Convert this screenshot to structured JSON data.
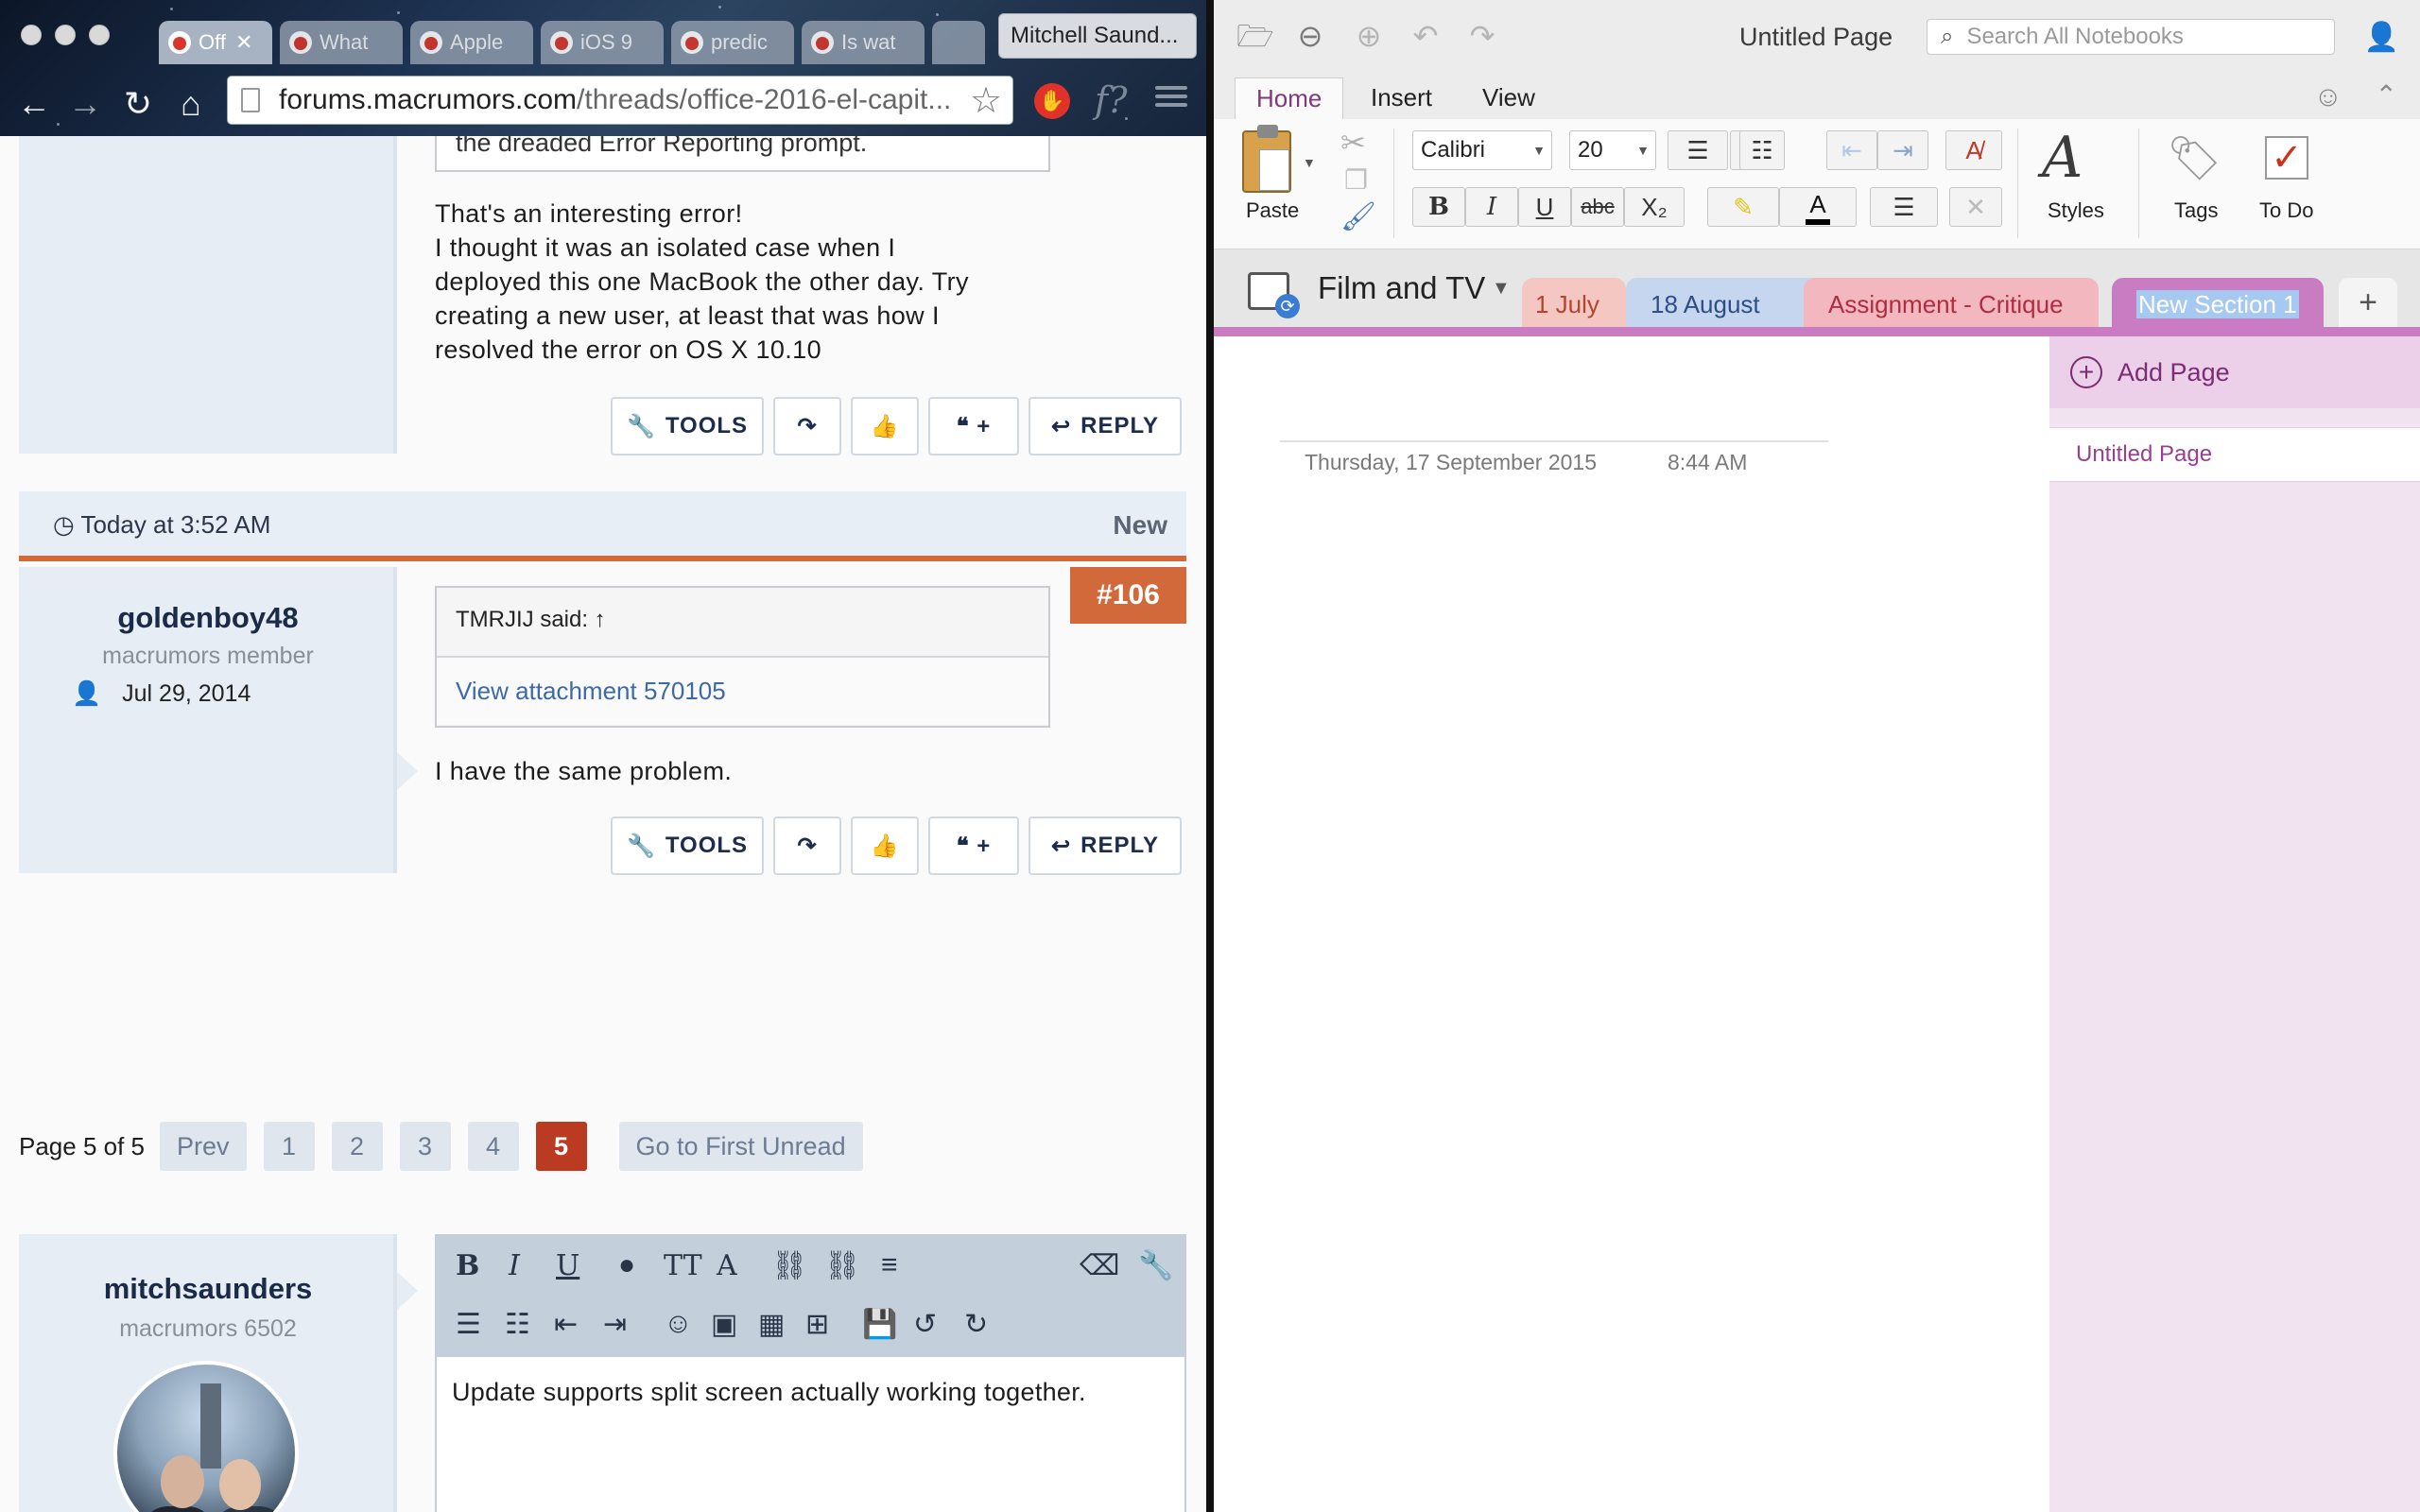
{
  "browser": {
    "tabs": [
      {
        "label": "Off",
        "active": true
      },
      {
        "label": "What"
      },
      {
        "label": "Apple"
      },
      {
        "label": "iOS 9"
      },
      {
        "label": "predic"
      },
      {
        "label": "Is wat"
      }
    ],
    "profile_name": "Mitchell Saund...",
    "url_host": "forums.macrumors.com",
    "url_path": "/threads/office-2016-el-capit...",
    "ext_icon_glyph": "✋",
    "ext2_glyph": "f?"
  },
  "forum": {
    "prev_post": {
      "quote_tail": "the dreaded Error Reporting prompt.",
      "lines": [
        "That's an interesting error!",
        "I thought it was an isolated case when I",
        "deployed this one MacBook the other day. Try",
        "creating a new user, at least that was how I",
        "resolved the error on OS X 10.10"
      ]
    },
    "buttons": {
      "tools": "TOOLS",
      "share_icon": "share-icon",
      "like_icon": "thumbs-up-icon",
      "quote_label": "❝ +",
      "reply": "REPLY"
    },
    "post106": {
      "date": "Today at 3:52 AM",
      "new_label": "New",
      "number": "#106",
      "username": "goldenboy48",
      "user_title": "macrumors member",
      "join_date": "Jul 29, 2014",
      "quote_author": "TMRJIJ said: ↑",
      "quote_link": "View attachment 570105",
      "body": "I have the same problem."
    },
    "pagination": {
      "label": "Page 5 of 5",
      "prev": "Prev",
      "pages": [
        "1",
        "2",
        "3",
        "4",
        "5"
      ],
      "current": "5",
      "first_unread": "Go to First Unread"
    },
    "reply_box": {
      "username": "mitchsaunders",
      "user_title": "macrumors 6502",
      "text": "Update supports split screen actually working together."
    }
  },
  "onenote": {
    "page_title": "Untitled Page",
    "search_placeholder": "Search All Notebooks",
    "ribbon_tabs": [
      "Home",
      "Insert",
      "View"
    ],
    "active_tab": "Home",
    "paste_label": "Paste",
    "font_name": "Calibri",
    "font_size": "20",
    "styles_label": "Styles",
    "tags_label": "Tags",
    "todo_label": "To Do",
    "notebook": "Film and TV",
    "sections": [
      "1 July",
      "18 August",
      "Assignment - Critique",
      "New Section 1"
    ],
    "active_section": "New Section 1",
    "page_date": "Thursday, 17 September 2015",
    "page_time": "8:44 AM",
    "add_page": "Add Page",
    "pages": [
      "Untitled Page"
    ],
    "accent": "#80397b"
  }
}
